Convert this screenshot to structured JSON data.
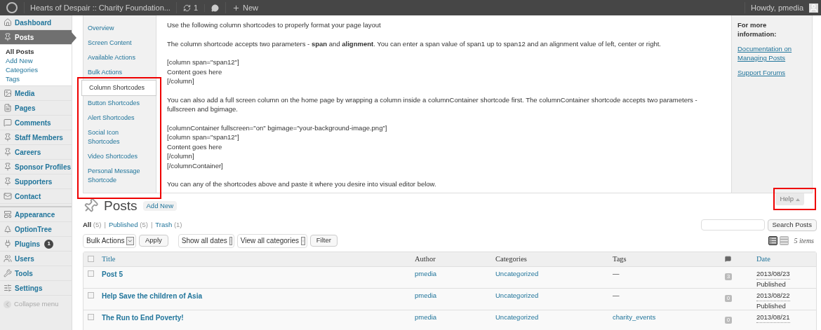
{
  "admin_bar": {
    "site_title": "Hearts of Despair :: Charity Foundation...",
    "updates": "1",
    "new": "New",
    "greeting": "Howdy, pmedia"
  },
  "sidebar": {
    "items": [
      {
        "label": "Dashboard",
        "selected": false
      },
      {
        "label": "Posts",
        "selected": true,
        "children": [
          {
            "label": "All Posts",
            "selected": true
          },
          {
            "label": "Add New",
            "selected": false
          },
          {
            "label": "Categories",
            "selected": false
          },
          {
            "label": "Tags",
            "selected": false
          }
        ]
      },
      {
        "label": "Media",
        "selected": false
      },
      {
        "label": "Pages",
        "selected": false
      },
      {
        "label": "Comments",
        "selected": false
      },
      {
        "label": "Staff Members",
        "selected": false
      },
      {
        "label": "Careers",
        "selected": false
      },
      {
        "label": "Sponsor Profiles",
        "selected": false
      },
      {
        "label": "Supporters",
        "selected": false
      },
      {
        "label": "Contact",
        "selected": false
      },
      {
        "label": "Appearance",
        "selected": false
      },
      {
        "label": "OptionTree",
        "selected": false
      },
      {
        "label": "Plugins",
        "selected": false,
        "badge": "1"
      },
      {
        "label": "Users",
        "selected": false
      },
      {
        "label": "Tools",
        "selected": false
      },
      {
        "label": "Settings",
        "selected": false
      }
    ],
    "collapse": "Collapse menu"
  },
  "help": {
    "tabs": [
      {
        "label": "Overview",
        "selected": false
      },
      {
        "label": "Screen Content",
        "selected": false
      },
      {
        "label": "Available Actions",
        "selected": false
      },
      {
        "label": "Bulk Actions",
        "selected": false
      },
      {
        "label": "Column Shortcodes",
        "selected": true
      },
      {
        "label": "Button Shortcodes",
        "selected": false
      },
      {
        "label": "Alert Shortcodes",
        "selected": false
      },
      {
        "label": "Social Icon Shortcodes",
        "selected": false
      },
      {
        "label": "Video Shortcodes",
        "selected": false
      },
      {
        "label": "Personal Message Shortcode",
        "selected": false
      }
    ],
    "content": [
      [
        "Use the following column shortcodes to properly format your page layout"
      ],
      [
        "The column shortcode accepts two parameters - **span** and **alignment**. You can enter a span value of span1 up to span12 and an alignment value of left, center or right."
      ],
      [
        "[column span=\"span12\"]",
        "Content goes here",
        "[/column]"
      ],
      [
        "You can also add a full screen column on the home page by wrapping a column inside a columnContainer shortcode first. The columnContainer shortcode accepts two parameters - fullscreen and bgimage."
      ],
      [
        "[columnContainer fullscreen=\"on\" bgimage=\"your-background-image.png\"]",
        "[column span=\"span12\"]",
        "Content goes here",
        "[/column]",
        "[/columnContainer]"
      ],
      [
        "You can any of the shortcodes above and paste it where you desire into visual editor below."
      ]
    ],
    "sidebar_title": "For more information:",
    "links": [
      "Documentation on Managing Posts",
      "Support Forums"
    ],
    "toggle": "Help"
  },
  "page": {
    "title": "Posts",
    "add_new": "Add New",
    "separator": "|",
    "views": [
      {
        "label": "All",
        "count": "(5)",
        "selected": true
      },
      {
        "label": "Published",
        "count": "(5)",
        "selected": false
      },
      {
        "label": "Trash",
        "count": "(1)",
        "selected": false
      }
    ],
    "bulk_actions": "Bulk Actions",
    "apply": "Apply",
    "dates": "Show all dates",
    "categories": "View all categories",
    "filter": "Filter",
    "search_button": "Search Posts",
    "view_modes": [
      {
        "selected": true
      },
      {
        "selected": false
      }
    ],
    "items_count": "5 items"
  },
  "table": {
    "select_all_checked": false,
    "columns": [
      "Title",
      "Author",
      "Categories",
      "Tags",
      "Date"
    ],
    "rows": [
      {
        "checked": false,
        "title": "Post 5",
        "author": "pmedia",
        "categories": "Uncategorized",
        "tags": "—",
        "comments": "3",
        "date": "2013/08/23",
        "status": "Published"
      },
      {
        "checked": false,
        "title": "Help Save the children of Asia",
        "author": "pmedia",
        "categories": "Uncategorized",
        "tags": "—",
        "comments": "0",
        "date": "2013/08/22",
        "status": "Published"
      },
      {
        "checked": false,
        "title": "The Run to End Poverty!",
        "author": "pmedia",
        "categories": "Uncategorized",
        "tags": "charity_events",
        "comments": "0",
        "date": "2013/08/21"
      }
    ]
  }
}
